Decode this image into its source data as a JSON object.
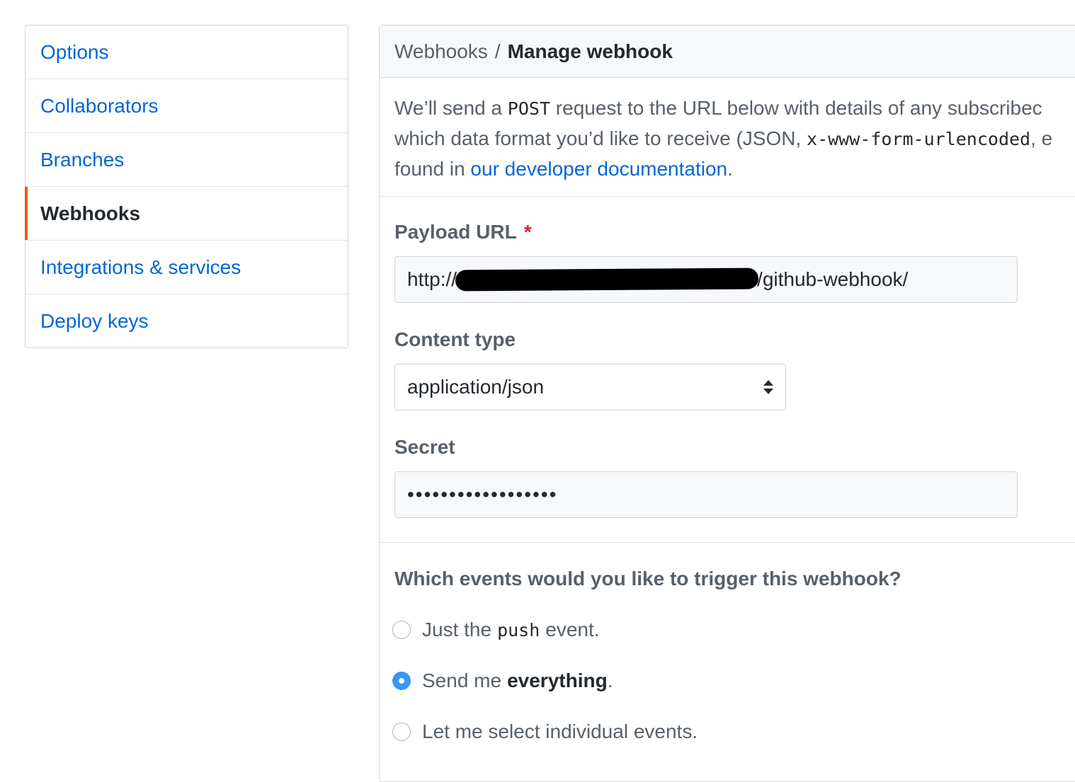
{
  "sidebar": {
    "items": [
      {
        "label": "Options"
      },
      {
        "label": "Collaborators"
      },
      {
        "label": "Branches"
      },
      {
        "label": "Webhooks",
        "selected": true
      },
      {
        "label": "Integrations & services"
      },
      {
        "label": "Deploy keys"
      }
    ]
  },
  "header": {
    "breadcrumb_parent": "Webhooks",
    "separator": "/",
    "current": "Manage webhook"
  },
  "intro": {
    "line1_before": "We’ll send a ",
    "line1_code": "POST",
    "line1_after": " request to the URL below with details of any subscribec",
    "line2_before": "which data format you’d like to receive (JSON, ",
    "line2_code": "x-www-form-urlencoded",
    "line2_after": ", e",
    "line3_before": "found in ",
    "line3_link": "our developer documentation",
    "line3_after": "."
  },
  "payload_url": {
    "label": "Payload URL",
    "required_mark": "*",
    "value_prefix": "http://",
    "value_suffix": "/github-webhook/"
  },
  "content_type": {
    "label": "Content type",
    "selected": "application/json"
  },
  "secret": {
    "label": "Secret",
    "masked_value": "••••••••••••••••••"
  },
  "events": {
    "question": "Which events would you like to trigger this webhook?",
    "options": [
      {
        "before": "Just the",
        "code": "push",
        "after": "event.",
        "checked": false
      },
      {
        "before": "Send me",
        "bold": "everything",
        "after": ".",
        "checked": true
      },
      {
        "label": "Let me select individual events.",
        "checked": false
      }
    ]
  },
  "colors": {
    "link": "#0366d6",
    "selected_accent": "#e36209",
    "radio_checked": "#3b95f5",
    "required": "#cb2431"
  }
}
